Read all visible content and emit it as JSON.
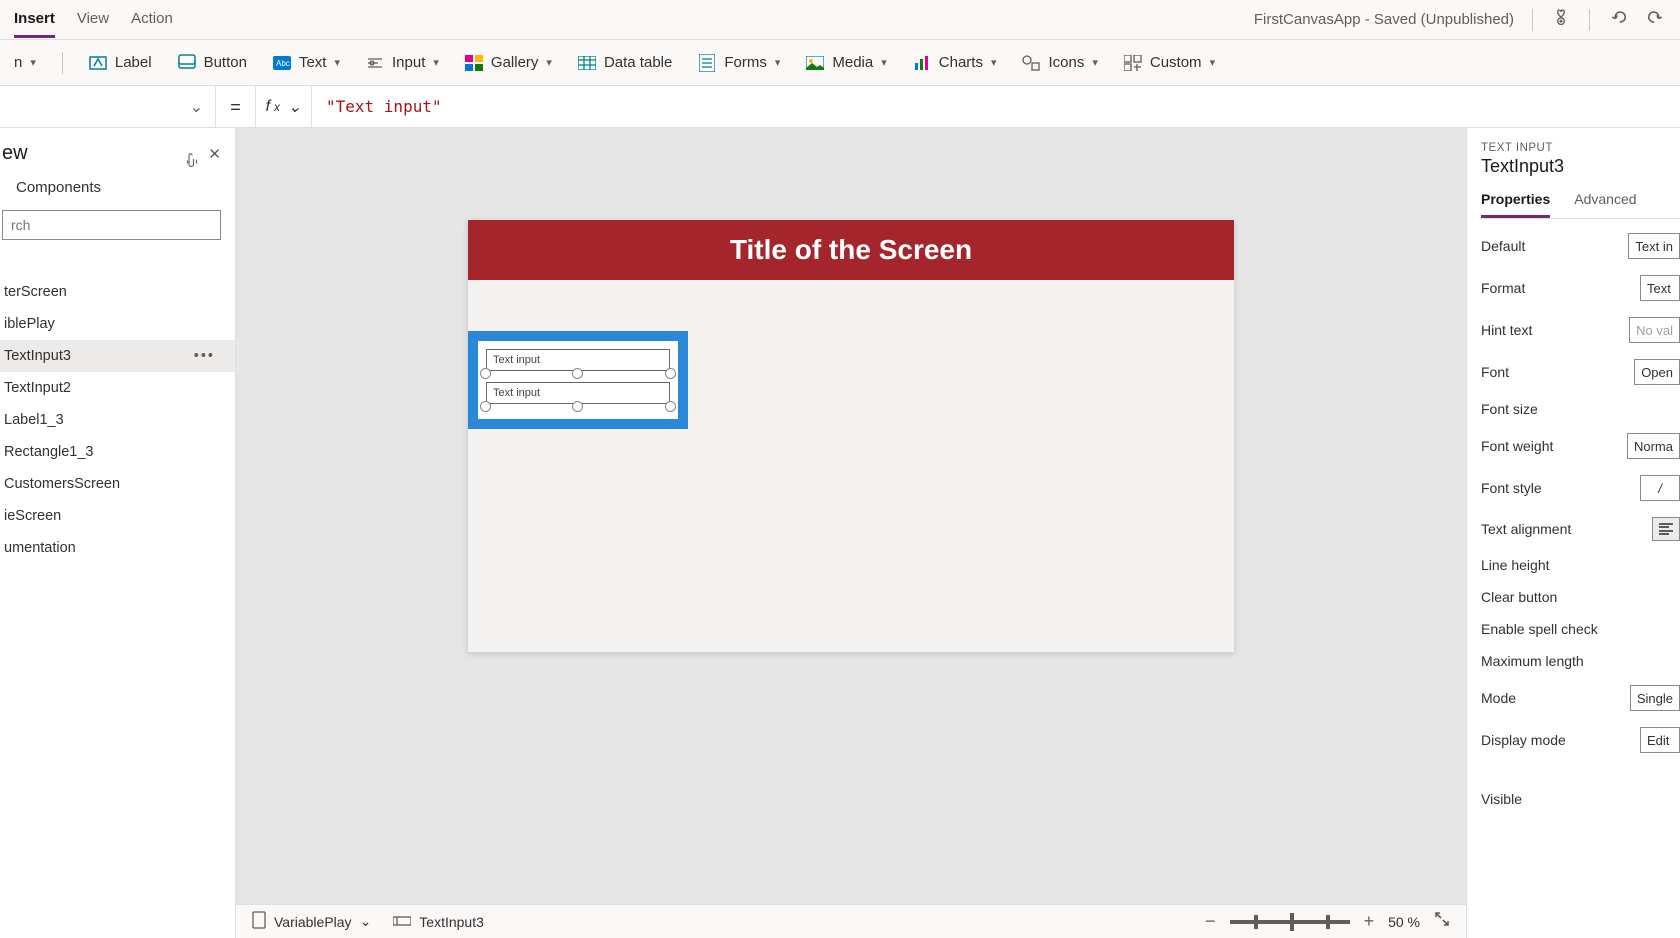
{
  "topMenu": {
    "tabs": [
      "Insert",
      "View",
      "Action"
    ],
    "activeTab": 0,
    "appTitle": "FirstCanvasApp - Saved (Unpublished)"
  },
  "ribbon": {
    "firstDropdown": "n",
    "items": [
      {
        "label": "Label",
        "hasDropdown": false,
        "iconColor": "#038387"
      },
      {
        "label": "Button",
        "hasDropdown": false,
        "iconColor": "#038387"
      },
      {
        "label": "Text",
        "hasDropdown": true,
        "iconColor": "#0078d4"
      },
      {
        "label": "Input",
        "hasDropdown": true,
        "iconColor": "#605e5c"
      },
      {
        "label": "Gallery",
        "hasDropdown": true,
        "iconColor": "#8764b8"
      },
      {
        "label": "Data table",
        "hasDropdown": false,
        "iconColor": "#038387"
      },
      {
        "label": "Forms",
        "hasDropdown": true,
        "iconColor": "#038387"
      },
      {
        "label": "Media",
        "hasDropdown": true,
        "iconColor": "#0078d4"
      },
      {
        "label": "Charts",
        "hasDropdown": true,
        "iconColor": "#107c10"
      },
      {
        "label": "Icons",
        "hasDropdown": true,
        "iconColor": "#605e5c"
      },
      {
        "label": "Custom",
        "hasDropdown": true,
        "iconColor": "#605e5c"
      }
    ]
  },
  "formulaBar": {
    "value": "\"Text input\""
  },
  "tree": {
    "title": "ew",
    "subTab": "Components",
    "searchPlaceholder": "rch",
    "items": [
      {
        "label": "terScreen",
        "selected": false
      },
      {
        "label": "iblePlay",
        "selected": false
      },
      {
        "label": "TextInput3",
        "selected": true
      },
      {
        "label": "TextInput2",
        "selected": false
      },
      {
        "label": "Label1_3",
        "selected": false
      },
      {
        "label": "Rectangle1_3",
        "selected": false
      },
      {
        "label": "CustomersScreen",
        "selected": false
      },
      {
        "label": "ieScreen",
        "selected": false
      },
      {
        "label": "umentation",
        "selected": false
      }
    ]
  },
  "canvas": {
    "screenTitle": "Title of the Screen",
    "textInput1": "Text input",
    "textInput2": "Text input"
  },
  "statusBar": {
    "screenCrumb": "VariablePlay",
    "controlCrumb": "TextInput3",
    "zoomValue": "50",
    "zoomUnit": "%"
  },
  "props": {
    "type": "TEXT INPUT",
    "name": "TextInput3",
    "tabs": [
      "Properties",
      "Advanced"
    ],
    "activeTab": 0,
    "rows": [
      {
        "label": "Default",
        "value": "Text in",
        "kind": "input"
      },
      {
        "label": "Format",
        "value": "Text",
        "kind": "input"
      },
      {
        "label": "Hint text",
        "value": "No val",
        "kind": "placeholder"
      },
      {
        "label": "Font",
        "value": "Open ",
        "kind": "input"
      },
      {
        "label": "Font size",
        "value": "",
        "kind": "none"
      },
      {
        "label": "Font weight",
        "value": "Norma",
        "kind": "input"
      },
      {
        "label": "Font style",
        "value": "/",
        "kind": "input-center"
      },
      {
        "label": "Text alignment",
        "value": "",
        "kind": "align"
      },
      {
        "label": "Line height",
        "value": "",
        "kind": "none"
      },
      {
        "label": "Clear button",
        "value": "",
        "kind": "none"
      },
      {
        "label": "Enable spell check",
        "value": "",
        "kind": "none"
      },
      {
        "label": "Maximum length",
        "value": "",
        "kind": "none"
      },
      {
        "label": "Mode",
        "value": "Single",
        "kind": "input"
      },
      {
        "label": "Display mode",
        "value": "Edit",
        "kind": "input"
      },
      {
        "label": "Visible",
        "value": "",
        "kind": "none"
      }
    ]
  }
}
